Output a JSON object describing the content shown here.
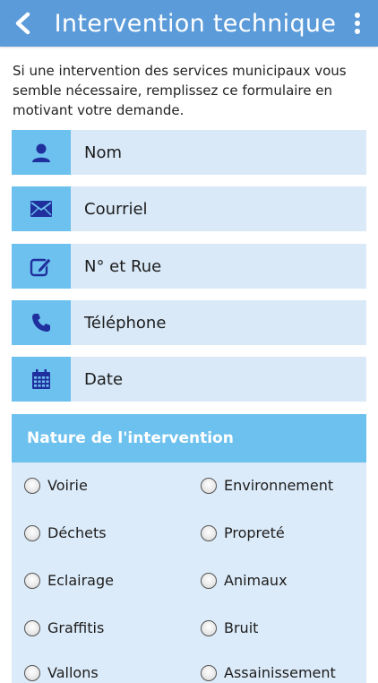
{
  "header": {
    "title": "Intervention technique",
    "back_icon": "chevron-left-icon",
    "menu_icon": "more-vert-icon"
  },
  "intro": "Si une intervention des services municipaux vous semble nécessaire, remplissez ce formulaire en motivant votre demande.",
  "fields": [
    {
      "icon": "user-icon",
      "label": "Nom"
    },
    {
      "icon": "mail-icon",
      "label": "Courriel"
    },
    {
      "icon": "edit-icon",
      "label": "N° et Rue"
    },
    {
      "icon": "phone-icon",
      "label": "Téléphone"
    },
    {
      "icon": "calendar-icon",
      "label": "Date"
    }
  ],
  "nature": {
    "title": "Nature de l'intervention",
    "options": [
      "Voirie",
      "Environnement",
      "Déchets",
      "Propreté",
      "Eclairage",
      "Animaux",
      "Graffitis",
      "Bruit",
      "Vallons",
      "Assainissement"
    ]
  },
  "colors": {
    "appbar": "#5b9bd9",
    "icon_bg": "#6dc1ee",
    "field_bg": "#d9e9f8",
    "icon_fg": "#1f2f9e"
  }
}
